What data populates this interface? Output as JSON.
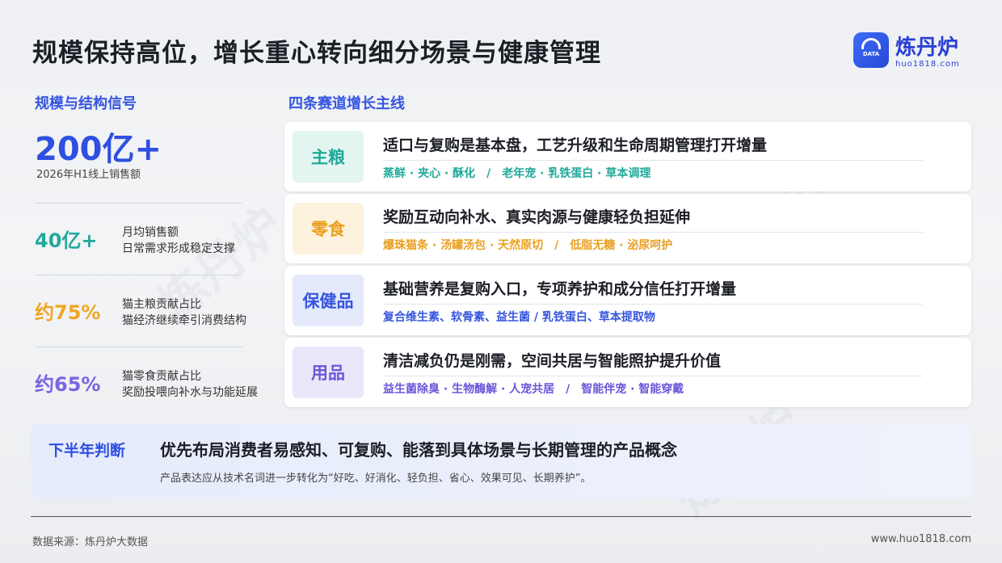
{
  "page": {
    "title": "规模保持高位，增长重心转向细分场景与健康管理"
  },
  "logo": {
    "name": "炼丹炉",
    "url": "huo1818.com",
    "badge_text": "DATA"
  },
  "left": {
    "section_label": "规模与结构信号",
    "headline_value": "200亿+",
    "headline_caption": "2026年H1线上销售额",
    "stats": [
      {
        "value": "40亿+",
        "line1": "月均销售额",
        "line2": "日常需求形成稳定支撑",
        "color": "#21a99a"
      },
      {
        "value": "约75%",
        "line1": "猫主粮贡献占比",
        "line2": "猫经济继续牵引消费结构",
        "color": "#f0a623"
      },
      {
        "value": "约65%",
        "line1": "猫零食贡献占比",
        "line2": "奖励投喂向补水与功能延展",
        "color": "#7b63e3"
      }
    ]
  },
  "right": {
    "section_label": "四条赛道增长主线",
    "cards": [
      {
        "tag": "主粮",
        "headline": "适口与复购是基本盘，工艺升级和生命周期管理打开增量",
        "keys": "蒸鲜 · 夹心 · 酥化　/　老年宠 · 乳铁蛋白 · 草本调理",
        "color": "#21a99a",
        "bg": "#e3f5f1"
      },
      {
        "tag": "零食",
        "headline": "奖励互动向补水、真实肉源与健康轻负担延伸",
        "keys": "爆珠猫条 · 汤罐汤包 · 天然原切　/　低脂无糖 · 泌尿呵护",
        "color": "#e9a021",
        "bg": "#fdf2dd"
      },
      {
        "tag": "保健品",
        "headline": "基础营养是复购入口，专项养护和成分信任打开增量",
        "keys": "复合维生素、软骨素、益生菌 / 乳铁蛋白、草本提取物",
        "color": "#3555e0",
        "bg": "#e4e9fb"
      },
      {
        "tag": "用品",
        "headline": "清洁减负仍是刚需，空间共居与智能照护提升价值",
        "keys": "益生菌除臭 · 生物酶解 · 人宠共居　/　智能伴宠 · 智能穿戴",
        "color": "#6c55d8",
        "bg": "#ebe6fa"
      }
    ]
  },
  "judgement": {
    "label": "下半年判断",
    "headline": "优先布局消费者易感知、可复购、能落到具体场景与长期管理的产品概念",
    "detail": "产品表达应从技术名词进一步转化为“好吃、好消化、轻负担、省心、效果可见、长期养护”。"
  },
  "footer": {
    "source": "数据来源：炼丹炉大数据",
    "website": "www.huo1818.com"
  }
}
